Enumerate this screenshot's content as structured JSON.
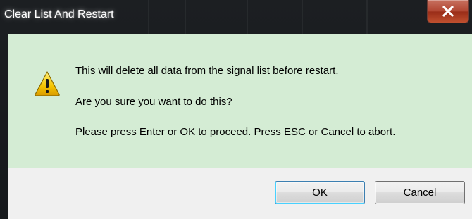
{
  "window": {
    "title": "Clear List And Restart"
  },
  "titlebar": {
    "close_icon": "close-x-icon"
  },
  "message": {
    "icon": "warning-icon",
    "line1": "This will delete all data from the signal list before restart.",
    "line2": "Are you sure you want to do this?",
    "line3": "Please press Enter or OK to proceed. Press ESC or Cancel to abort."
  },
  "buttons": {
    "ok_label": "OK",
    "cancel_label": "Cancel"
  },
  "colors": {
    "message_background": "#d4ecd4",
    "button_area_background": "#f0f0f0",
    "close_button": "#c0402a",
    "warning_yellow": "#f5c400"
  }
}
